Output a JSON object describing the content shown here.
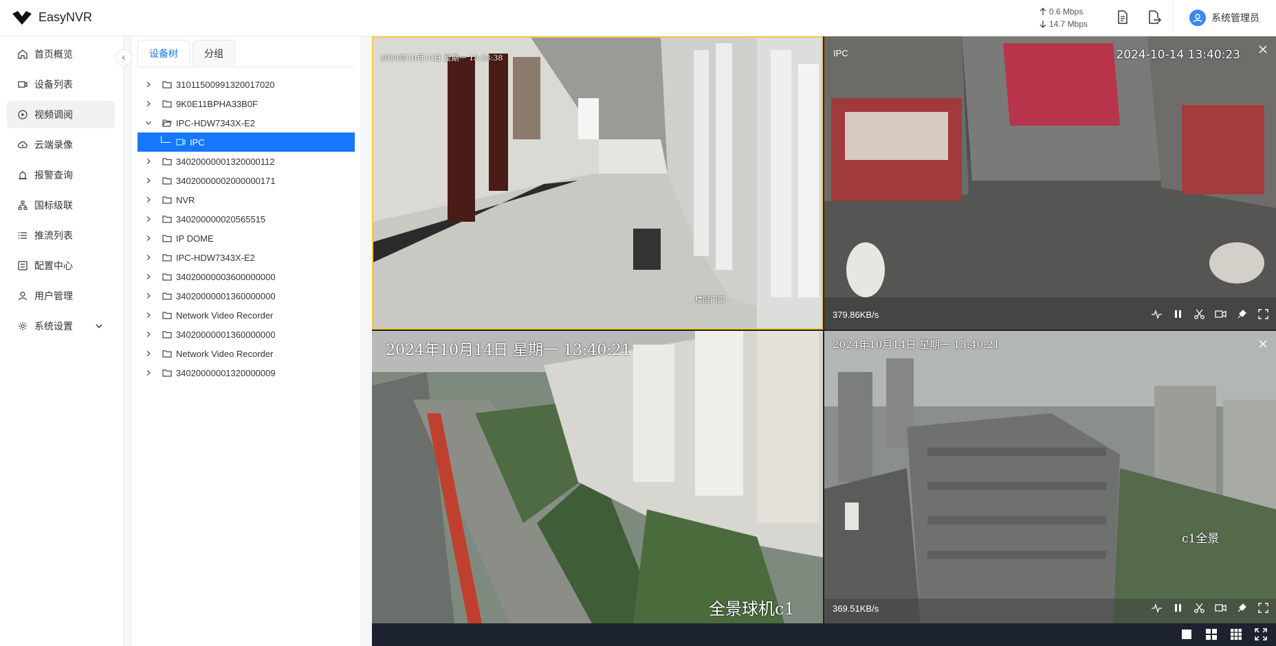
{
  "app": {
    "title": "EasyNVR"
  },
  "header": {
    "upload": "0.6 Mbps",
    "download": "14.7 Mbps",
    "user_name": "系统管理员"
  },
  "sidebar": {
    "items": [
      {
        "label": "首页概览",
        "icon": "home-icon"
      },
      {
        "label": "设备列表",
        "icon": "camera-icon"
      },
      {
        "label": "视频调阅",
        "icon": "play-circle-icon",
        "active": true
      },
      {
        "label": "云端录像",
        "icon": "cloud-icon"
      },
      {
        "label": "报警查询",
        "icon": "alarm-icon"
      },
      {
        "label": "国标级联",
        "icon": "cascade-icon"
      },
      {
        "label": "推流列表",
        "icon": "list-icon"
      },
      {
        "label": "配置中心",
        "icon": "config-icon"
      },
      {
        "label": "用户管理",
        "icon": "user-icon"
      },
      {
        "label": "系统设置",
        "icon": "gear-icon",
        "expandable": true
      }
    ]
  },
  "tree_panel": {
    "tabs": [
      "设备树",
      "分组"
    ],
    "active_tab": "设备树",
    "nodes": [
      "31011500991320017020",
      "9K0E11BPHA33B0F",
      "IPC-HDW7343X-E2",
      "IPC",
      "34020000001320000112",
      "34020000002000000171",
      "NVR",
      "340200000020565515",
      "IP DOME",
      "IPC-HDW7343X-E2",
      "34020000003600000000",
      "34020000001360000000",
      "Network Video Recorder",
      "34020000001360000000",
      "Network Video Recorder",
      "34020000001320000009"
    ]
  },
  "videos": [
    {
      "osd_time": "2024年10月14日  星期一  13:38:38",
      "osd_caption": "楼层门口",
      "selected": true
    },
    {
      "label": "IPC",
      "osd_time": "2024-10-14 13:40:23",
      "bitrate": "379.86KB/s"
    },
    {
      "osd_time": "2024年10月14日  星期一  13:40:21",
      "osd_caption": "全景球机c1"
    },
    {
      "osd_time": "2024年10月14日  星期一  13:40:21",
      "osd_caption": "c1全景",
      "bitrate": "369.51KB/s"
    }
  ]
}
